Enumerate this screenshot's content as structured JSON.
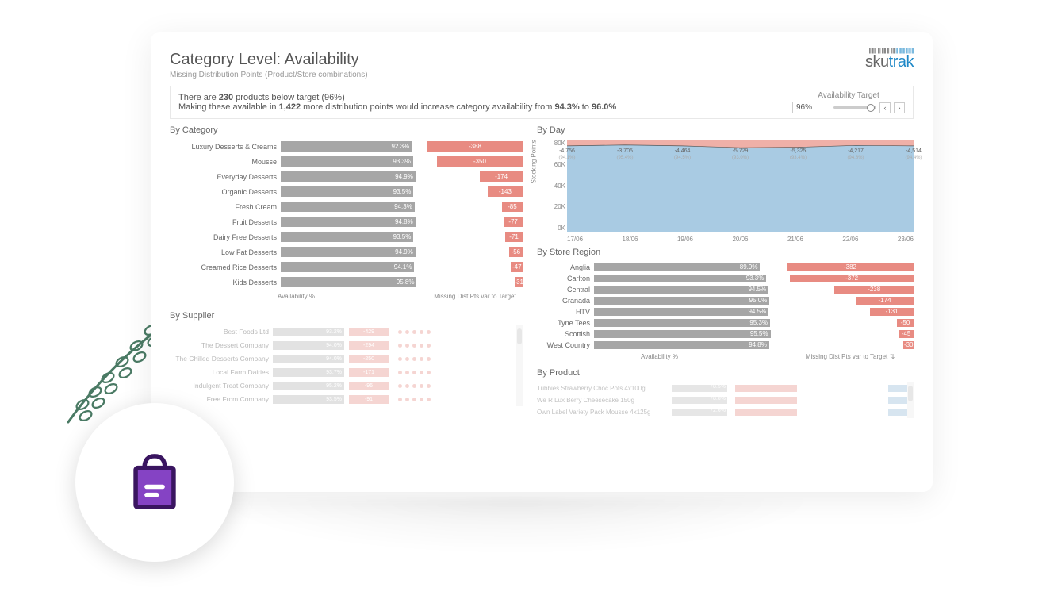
{
  "header": {
    "title": "Category Level: Availability",
    "subtitle": "Missing Distribution Points (Product/Store combinations)",
    "brand_a": "sku",
    "brand_b": "trak"
  },
  "summary": {
    "line1_a": "There are ",
    "count": "230",
    "line1_b": " products below target (96%)",
    "line2_a": "Making these available in ",
    "pts": "1,422",
    "line2_b": " more distribution points would increase category availability from ",
    "from": "94.3%",
    "mid": " to ",
    "to": "96.0%"
  },
  "target": {
    "label": "Availability Target",
    "value": "96%"
  },
  "category": {
    "title": "By Category",
    "axis1": "Availability %",
    "axis2": "Missing Dist Pts var to Target",
    "rows": [
      {
        "label": "Luxury Desserts & Creams",
        "pct": "92.3%",
        "neg": "-388"
      },
      {
        "label": "Mousse",
        "pct": "93.3%",
        "neg": "-350"
      },
      {
        "label": "Everyday Desserts",
        "pct": "94.9%",
        "neg": "-174"
      },
      {
        "label": "Organic Desserts",
        "pct": "93.5%",
        "neg": "-143"
      },
      {
        "label": "Fresh Cream",
        "pct": "94.3%",
        "neg": "-85"
      },
      {
        "label": "Fruit Desserts",
        "pct": "94.8%",
        "neg": "-77"
      },
      {
        "label": "Dairy Free Desserts",
        "pct": "93.5%",
        "neg": "-71"
      },
      {
        "label": "Low Fat Desserts",
        "pct": "94.9%",
        "neg": "-56"
      },
      {
        "label": "Creamed Rice Desserts",
        "pct": "94.1%",
        "neg": "-47"
      },
      {
        "label": "Kids Desserts",
        "pct": "95.8%",
        "neg": "-31"
      }
    ]
  },
  "byday": {
    "title": "By Day",
    "points": [
      {
        "x": "17/06",
        "neg": "-4,756",
        "pct": "(94.1%)"
      },
      {
        "x": "18/06",
        "neg": "-3,705",
        "pct": "(95.4%)"
      },
      {
        "x": "19/06",
        "neg": "-4,464",
        "pct": "(94.5%)"
      },
      {
        "x": "20/06",
        "neg": "-5,729",
        "pct": "(93.0%)"
      },
      {
        "x": "21/06",
        "neg": "-5,325",
        "pct": "(93.4%)"
      },
      {
        "x": "22/06",
        "neg": "-4,217",
        "pct": "(94.8%)"
      },
      {
        "x": "23/06",
        "neg": "-4,514",
        "pct": "(94.4%)"
      }
    ],
    "yticks": [
      "80K",
      "60K",
      "40K",
      "20K",
      "0K"
    ],
    "ylabel": "Stocking Points"
  },
  "region": {
    "title": "By Store Region",
    "axis1": "Availability %",
    "axis2": "Missing Dist Pts var to Target",
    "rows": [
      {
        "label": "Anglia",
        "pct": "89.9%",
        "neg": "-382"
      },
      {
        "label": "Carlton",
        "pct": "93.3%",
        "neg": "-372"
      },
      {
        "label": "Central",
        "pct": "94.5%",
        "neg": "-238"
      },
      {
        "label": "Granada",
        "pct": "95.0%",
        "neg": "-174"
      },
      {
        "label": "HTV",
        "pct": "94.5%",
        "neg": "-131"
      },
      {
        "label": "Tyne Tees",
        "pct": "95.3%",
        "neg": "-50"
      },
      {
        "label": "Scottish",
        "pct": "95.5%",
        "neg": "-45"
      },
      {
        "label": "West Country",
        "pct": "94.8%",
        "neg": "-30"
      }
    ]
  },
  "supplier": {
    "title": "By Supplier",
    "rows": [
      {
        "label": "Best Foods Ltd",
        "pct": "93.2%",
        "neg": "-429"
      },
      {
        "label": "The Dessert Company",
        "pct": "94.0%",
        "neg": "-294"
      },
      {
        "label": "The Chilled Desserts Company",
        "pct": "94.0%",
        "neg": "-250"
      },
      {
        "label": "Local Farm Dairies",
        "pct": "93.7%",
        "neg": "-171"
      },
      {
        "label": "Indulgent Treat Company",
        "pct": "95.2%",
        "neg": "-96"
      },
      {
        "label": "Free From Company",
        "pct": "93.5%",
        "neg": "-91"
      }
    ]
  },
  "product": {
    "title": "By Product",
    "rows": [
      {
        "label": "Tubbies Strawberry Choc Pots 4x100g",
        "pct": "78.5%",
        "neg": "-58"
      },
      {
        "label": "We R Lux Berry Cheesecake 150g",
        "pct": "78.8%",
        "neg": "-48"
      },
      {
        "label": "Own Label Variety Pack Mousse 4x125g",
        "pct": "72.6%",
        "neg": "-46"
      }
    ]
  },
  "chart_data": [
    {
      "type": "bar",
      "title": "By Category – Availability % / Missing Dist Pts var to Target",
      "xlabel": "Availability %",
      "ylabel": "",
      "categories": [
        "Luxury Desserts & Creams",
        "Mousse",
        "Everyday Desserts",
        "Organic Desserts",
        "Fresh Cream",
        "Fruit Desserts",
        "Dairy Free Desserts",
        "Low Fat Desserts",
        "Creamed Rice Desserts",
        "Kids Desserts"
      ],
      "series": [
        {
          "name": "Availability %",
          "values": [
            92.3,
            93.3,
            94.9,
            93.5,
            94.3,
            94.8,
            93.5,
            94.9,
            94.1,
            95.8
          ]
        },
        {
          "name": "Missing Dist Pts var to Target",
          "values": [
            -388,
            -350,
            -174,
            -143,
            -85,
            -77,
            -71,
            -56,
            -47,
            -31
          ]
        }
      ]
    },
    {
      "type": "area",
      "title": "By Day – Stocking Points",
      "xlabel": "",
      "ylabel": "Stocking Points",
      "ylim": [
        0,
        80000
      ],
      "categories": [
        "17/06",
        "18/06",
        "19/06",
        "20/06",
        "21/06",
        "22/06",
        "23/06"
      ],
      "series": [
        {
          "name": "Missing Dist Pts",
          "values": [
            -4756,
            -3705,
            -4464,
            -5729,
            -5325,
            -4217,
            -4514
          ]
        },
        {
          "name": "Availability %",
          "values": [
            94.1,
            95.4,
            94.5,
            93.0,
            93.4,
            94.8,
            94.4
          ]
        }
      ]
    },
    {
      "type": "bar",
      "title": "By Store Region – Availability % / Missing Dist Pts var to Target",
      "xlabel": "Availability %",
      "ylabel": "",
      "categories": [
        "Anglia",
        "Carlton",
        "Central",
        "Granada",
        "HTV",
        "Tyne Tees",
        "Scottish",
        "West Country"
      ],
      "series": [
        {
          "name": "Availability %",
          "values": [
            89.9,
            93.3,
            94.5,
            95.0,
            94.5,
            95.3,
            95.5,
            94.8
          ]
        },
        {
          "name": "Missing Dist Pts var to Target",
          "values": [
            -382,
            -372,
            -238,
            -174,
            -131,
            -50,
            -45,
            -30
          ]
        }
      ]
    },
    {
      "type": "bar",
      "title": "By Supplier – Availability % / Missing Dist Pts var to Target",
      "categories": [
        "Best Foods Ltd",
        "The Dessert Company",
        "The Chilled Desserts Company",
        "Local Farm Dairies",
        "Indulgent Treat Company",
        "Free From Company"
      ],
      "series": [
        {
          "name": "Availability %",
          "values": [
            93.2,
            94.0,
            94.0,
            93.7,
            95.2,
            93.5
          ]
        },
        {
          "name": "Missing Dist Pts var to Target",
          "values": [
            -429,
            -294,
            -250,
            -171,
            -96,
            -91
          ]
        }
      ]
    },
    {
      "type": "bar",
      "title": "By Product",
      "categories": [
        "Tubbies Strawberry Choc Pots 4x100g",
        "We R Lux Berry Cheesecake 150g",
        "Own Label Variety Pack Mousse 4x125g"
      ],
      "series": [
        {
          "name": "Availability %",
          "values": [
            78.5,
            78.8,
            72.6
          ]
        },
        {
          "name": "Missing Dist Pts var to Target",
          "values": [
            -58,
            -48,
            -46
          ]
        }
      ]
    }
  ]
}
